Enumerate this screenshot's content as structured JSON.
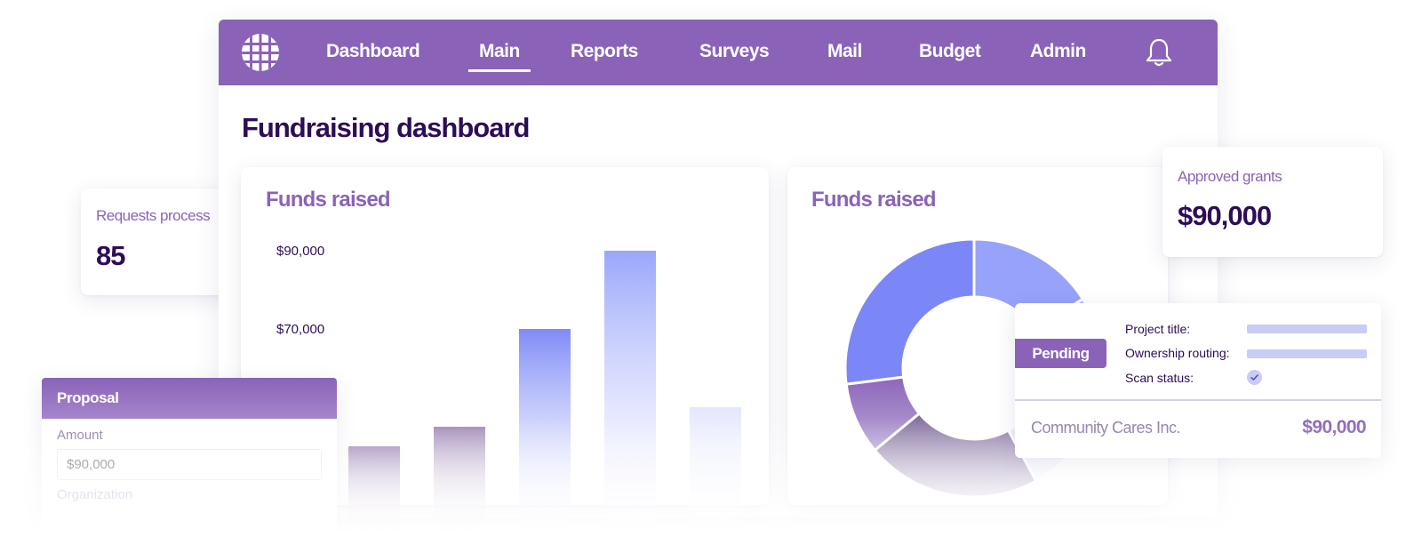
{
  "nav": {
    "items": [
      {
        "label": "Dashboard"
      },
      {
        "label": "Main"
      },
      {
        "label": "Reports"
      },
      {
        "label": "Surveys"
      },
      {
        "label": "Mail"
      },
      {
        "label": "Budget"
      },
      {
        "label": "Admin"
      }
    ],
    "active": "Main",
    "icons": [
      "logo-icon",
      "bell-icon"
    ]
  },
  "page_title": "Fundraising dashboard",
  "bar_panel": {
    "title": "Funds raised"
  },
  "donut_panel": {
    "title": "Funds raised"
  },
  "stats": {
    "requests": {
      "label": "Requests process",
      "value": "85"
    },
    "grants": {
      "label": "Approved grants",
      "value": "$90,000"
    }
  },
  "proposal": {
    "title": "Proposal",
    "amount_label": "Amount",
    "amount_placeholder": "$90,000",
    "organization_label": "Organization"
  },
  "pending": {
    "badge": "Pending",
    "rows": [
      {
        "label": "Project title:"
      },
      {
        "label": "Ownership routing:"
      },
      {
        "label": "Scan status:"
      }
    ],
    "organization": "Community Cares Inc.",
    "amount": "$90,000"
  },
  "colors": {
    "brand_purple": "#8a63b8",
    "dark_text": "#2d0d56",
    "blue": "#7b8af7",
    "light_blue": "#9aa5fa"
  },
  "chart_data": [
    {
      "type": "bar",
      "title": "Funds raised",
      "ytick_labels": [
        "$90,000",
        "$70,000"
      ],
      "values": [
        40000,
        45000,
        70000,
        90000,
        50000
      ],
      "ylim": [
        30000,
        90000
      ]
    },
    {
      "type": "pie",
      "title": "Funds raised",
      "values": [
        16,
        14,
        12,
        22,
        9,
        27
      ]
    }
  ]
}
